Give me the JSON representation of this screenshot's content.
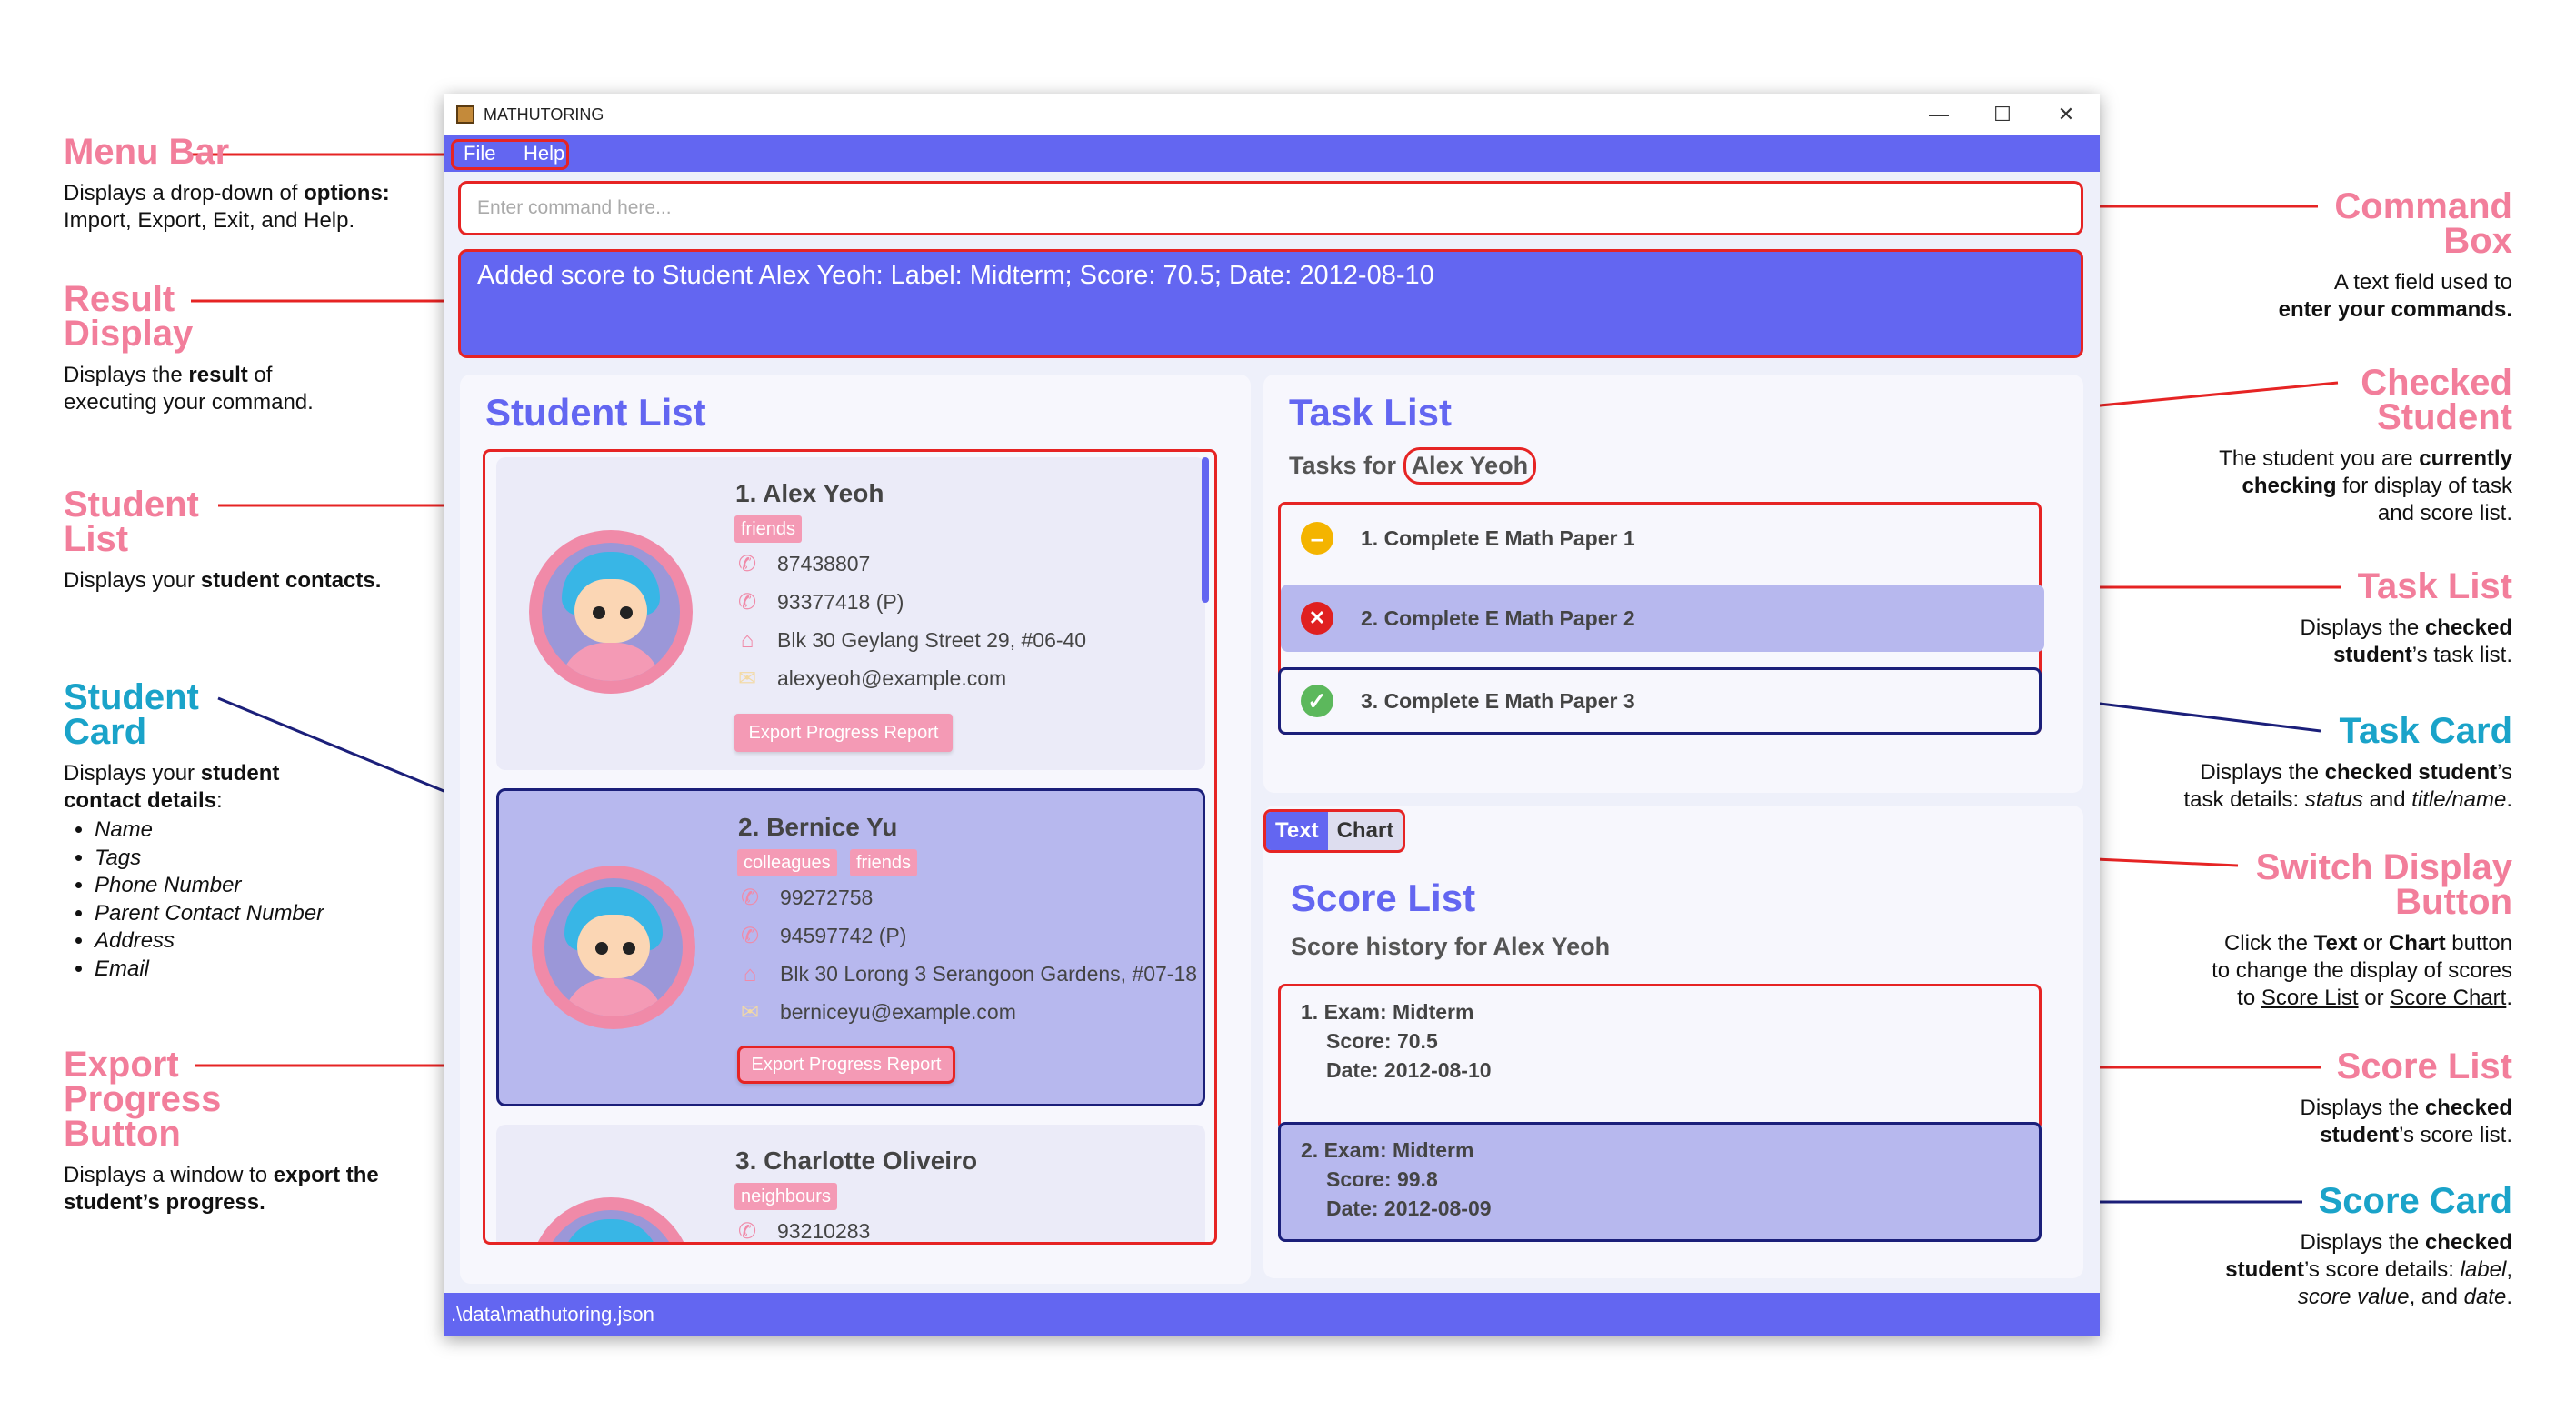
{
  "window": {
    "title": "MATHUTORING",
    "controls": [
      "—",
      "☐",
      "✕"
    ]
  },
  "menu": {
    "items": [
      "File",
      "Help"
    ]
  },
  "command_box": {
    "placeholder": "Enter command here..."
  },
  "result_display": {
    "text": "Added score to Student Alex Yeoh: Label: Midterm; Score: 70.5; Date: 2012-08-10"
  },
  "student_list": {
    "title": "Student List",
    "students": [
      {
        "index_name": "1.  Alex Yeoh",
        "tags": [
          "friends"
        ],
        "phone": "87438807",
        "parent_phone": "93377418 (P)",
        "address": "Blk 30 Geylang Street 29, #06-40",
        "email": "alexyeoh@example.com",
        "export": "Export Progress Report"
      },
      {
        "index_name": "2.  Bernice Yu",
        "tags": [
          "colleagues",
          "friends"
        ],
        "phone": "99272758",
        "parent_phone": "94597742 (P)",
        "address": "Blk 30 Lorong 3 Serangoon Gardens, #07-18",
        "email": "berniceyu@example.com",
        "export": "Export Progress Report"
      },
      {
        "index_name": "3.  Charlotte Oliveiro",
        "tags": [
          "neighbours"
        ],
        "phone": "93210283"
      }
    ]
  },
  "task_list": {
    "title": "Task List",
    "sub_prefix": "Tasks for ",
    "student": "Alex Yeoh",
    "tasks": [
      {
        "text": "1.  Complete E Math Paper 1",
        "status": "in-progress",
        "color": "#f4b400"
      },
      {
        "text": "2.  Complete E Math Paper 2",
        "status": "failed",
        "color": "#e02020"
      },
      {
        "text": "3.  Complete E Math Paper 3",
        "status": "done",
        "color": "#5cb85c"
      }
    ]
  },
  "display_toggle": {
    "text": "Text",
    "chart": "Chart",
    "active": "Text"
  },
  "score_list": {
    "title": "Score List",
    "subtitle": "Score history for Alex Yeoh",
    "scores": [
      {
        "label": "1. Exam: Midterm",
        "score": "Score: 70.5",
        "date": "Date: 2012-08-10"
      },
      {
        "label": "2. Exam: Midterm",
        "score": "Score: 99.8",
        "date": "Date: 2012-08-09"
      }
    ]
  },
  "status_bar": {
    "path": ".\\data\\mathutoring.json"
  },
  "annotations": {
    "menu_bar": {
      "title": "Menu Bar",
      "desc_a": "Displays a drop-down of ",
      "desc_b": "options:",
      "desc_c": "Import, Export, Exit, and Help."
    },
    "result_display": {
      "title_1": "Result",
      "title_2": "Display",
      "desc_a": "Displays the ",
      "desc_b": "result",
      "desc_c": " of",
      "desc_d": "executing your command."
    },
    "student_list": {
      "title_1": "Student",
      "title_2": "List",
      "desc_a": "Displays your ",
      "desc_b": "student contacts."
    },
    "student_card": {
      "title_1": "Student",
      "title_2": "Card",
      "desc_a": "Displays your ",
      "desc_b": "student",
      "desc_c": "contact details",
      "desc_d": ":",
      "bullets": [
        "Name",
        "Tags",
        "Phone Number",
        "Parent Contact Number",
        "Address",
        "Email"
      ]
    },
    "export_button": {
      "title_1": "Export",
      "title_2": "Progress",
      "title_3": "Button",
      "desc_a": "Displays a window to ",
      "desc_b": "export the",
      "desc_c": "student’s progress."
    },
    "command_box": {
      "title_1": "Command",
      "title_2": "Box",
      "desc_a": "A text field used to",
      "desc_b": "enter your commands."
    },
    "checked_student": {
      "title_1": "Checked",
      "title_2": "Student",
      "desc_a": "The student you are ",
      "desc_b": "currently",
      "desc_c": "checking",
      "desc_d": " for display of task",
      "desc_e": "and score list."
    },
    "task_list": {
      "title": "Task List",
      "desc_a": "Displays the ",
      "desc_b": "checked",
      "desc_c": "student",
      "desc_d": "’s task list."
    },
    "task_card": {
      "title": "Task Card",
      "desc_a": "Displays the ",
      "desc_b": "checked student",
      "desc_c": "’s",
      "desc_d": "task details: ",
      "desc_e": "status",
      "desc_f": " and ",
      "desc_g": "title/name",
      "desc_h": "."
    },
    "switch_button": {
      "title_1": "Switch Display",
      "title_2": "Button",
      "desc_a": "Click the ",
      "desc_b": "Text",
      "desc_c": " or ",
      "desc_d": "Chart",
      "desc_e": " button",
      "desc_f": "to change the display of scores",
      "desc_g": "to ",
      "desc_h": "Score List",
      "desc_i": " or ",
      "desc_j": "Score Chart",
      "desc_k": "."
    },
    "score_list": {
      "title": "Score List",
      "desc_a": "Displays the ",
      "desc_b": "checked",
      "desc_c": "student",
      "desc_d": "’s score list."
    },
    "score_card": {
      "title": "Score Card",
      "desc_a": "Displays the ",
      "desc_b": "checked",
      "desc_c": "student",
      "desc_d": "’s score details: ",
      "desc_e": "label",
      "desc_f": ",",
      "desc_g": "score value",
      "desc_h": ", and ",
      "desc_i": "date",
      "desc_j": "."
    }
  }
}
